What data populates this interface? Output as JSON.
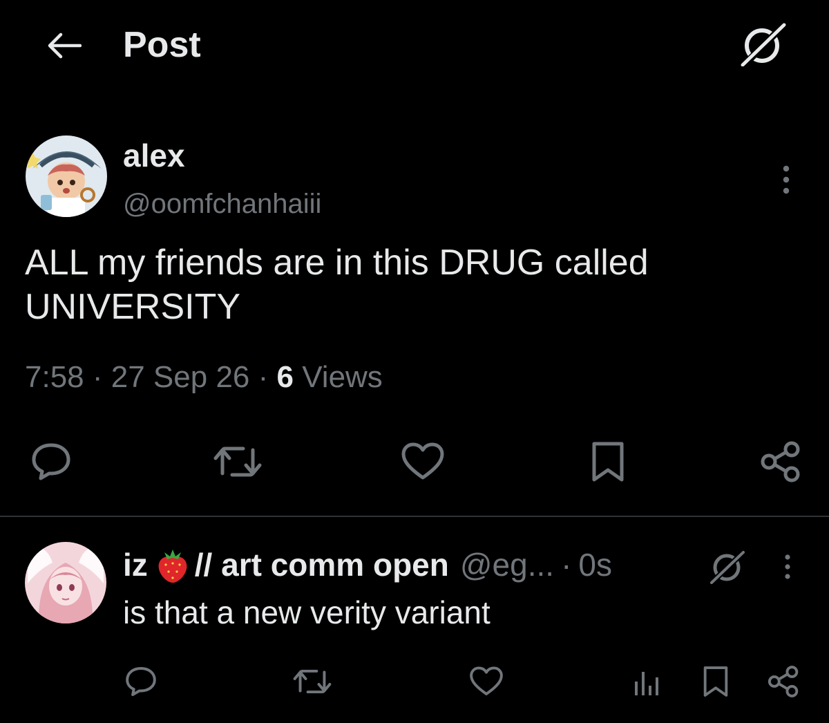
{
  "header": {
    "title": "Post",
    "back_icon": "arrow-left-icon",
    "action_icon": "grok-icon"
  },
  "post": {
    "author": {
      "name": "alex",
      "handle": "@oomfchanhaiii"
    },
    "text": "ALL my friends are in this DRUG called\nUNIVERSITY",
    "meta": {
      "time": "7:58",
      "separator": "·",
      "date": "27 Sep 26",
      "views_count": "6",
      "views_label": "Views"
    },
    "actions": [
      {
        "name": "reply",
        "icon": "reply-icon"
      },
      {
        "name": "repost",
        "icon": "repost-icon"
      },
      {
        "name": "like",
        "icon": "heart-icon"
      },
      {
        "name": "bookmark",
        "icon": "bookmark-icon"
      },
      {
        "name": "share",
        "icon": "share-icon"
      }
    ]
  },
  "reply": {
    "author": {
      "name_prefix": "iz",
      "name_emoji": "strawberry",
      "name_suffix": "// art comm open",
      "handle": "@eg...",
      "separator": "·",
      "time": "0s"
    },
    "text": "is that a new verity variant",
    "actions": [
      {
        "name": "reply",
        "icon": "reply-icon"
      },
      {
        "name": "repost",
        "icon": "repost-icon"
      },
      {
        "name": "like",
        "icon": "heart-icon"
      },
      {
        "name": "views",
        "icon": "bar-chart-icon"
      },
      {
        "name": "bookmark",
        "icon": "bookmark-icon"
      },
      {
        "name": "share",
        "icon": "share-icon"
      }
    ]
  },
  "colors": {
    "background": "#000000",
    "text_primary": "#e7e9ea",
    "text_secondary": "#71767b",
    "divider": "#2f3336",
    "strawberry_red": "#e0262a"
  }
}
